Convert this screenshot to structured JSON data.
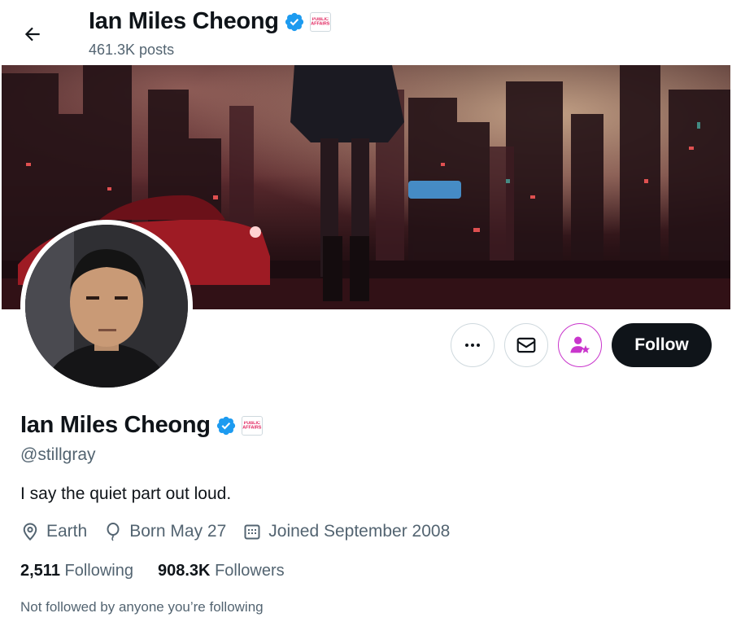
{
  "header": {
    "name": "Ian Miles Cheong",
    "posts_count": "461.3K posts"
  },
  "badges": {
    "verified_color": "#1d9bf0",
    "affiliation_text": "PUBLIC AFFAIRS"
  },
  "actions": {
    "more_icon": "more-horizontal-icon",
    "message_icon": "mail-icon",
    "subscribe_icon": "person-star-icon",
    "subscribe_color": "#c936cc",
    "follow_label": "Follow"
  },
  "profile": {
    "name": "Ian Miles Cheong",
    "handle": "@stillgray",
    "bio": "I say the quiet part out loud.",
    "location": "Earth",
    "birthday": "Born May 27",
    "joined": "Joined September 2008",
    "following_count": "2,511",
    "following_label": "Following",
    "followers_count": "908.3K",
    "followers_label": "Followers",
    "followed_by_note": "Not followed by anyone you’re following"
  }
}
